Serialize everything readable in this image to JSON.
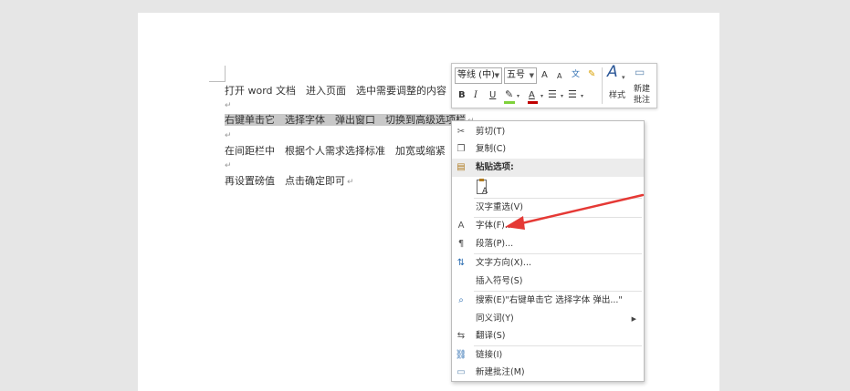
{
  "document": {
    "lines": [
      "打开 word 文档　进入页面　选中需要调整的内容",
      "右键单击它　选择字体　弹出窗口　切换到高级选项栏",
      "在间距栏中　根据个人需求选择标准　加宽或缩紧",
      "再设置磅值　点击确定即可"
    ],
    "paragraph_mark": "↵"
  },
  "mini_toolbar": {
    "font_name": "等线 (中)",
    "font_size": "五号",
    "grow_font": "A",
    "shrink_font": "A",
    "phonetic_guide": "文",
    "bold": "B",
    "italic": "I",
    "underline": "U",
    "font_color": "A",
    "styles_label": "样式",
    "new_comment_label_1": "新建",
    "new_comment_label_2": "批注"
  },
  "context_menu": {
    "items": [
      {
        "label": "剪切(T)",
        "icon": "scissors-icon"
      },
      {
        "label": "复制(C)",
        "icon": "copy-icon"
      },
      {
        "label": "粘贴选项:",
        "icon": "paste-icon"
      },
      {
        "label": "汉字重选(V)"
      },
      {
        "label": "字体(F)...",
        "icon": "font-icon"
      },
      {
        "label": "段落(P)...",
        "icon": "paragraph-icon"
      },
      {
        "label": "文字方向(X)...",
        "icon": "text-direction-icon"
      },
      {
        "label": "插入符号(S)"
      },
      {
        "label": "搜索(E)\"右键单击它 选择字体 弹出...\"",
        "icon": "search-icon"
      },
      {
        "label": "同义词(Y)",
        "icon": "chevron-right-icon"
      },
      {
        "label": "翻译(S)",
        "icon": "translate-icon"
      },
      {
        "label": "链接(I)",
        "icon": "link-icon"
      },
      {
        "label": "新建批注(M)",
        "icon": "comment-icon"
      }
    ]
  },
  "colors": {
    "highlight": "#7fd13b",
    "font_color_bar": "#c00000",
    "annotation_arrow": "#e53935"
  }
}
